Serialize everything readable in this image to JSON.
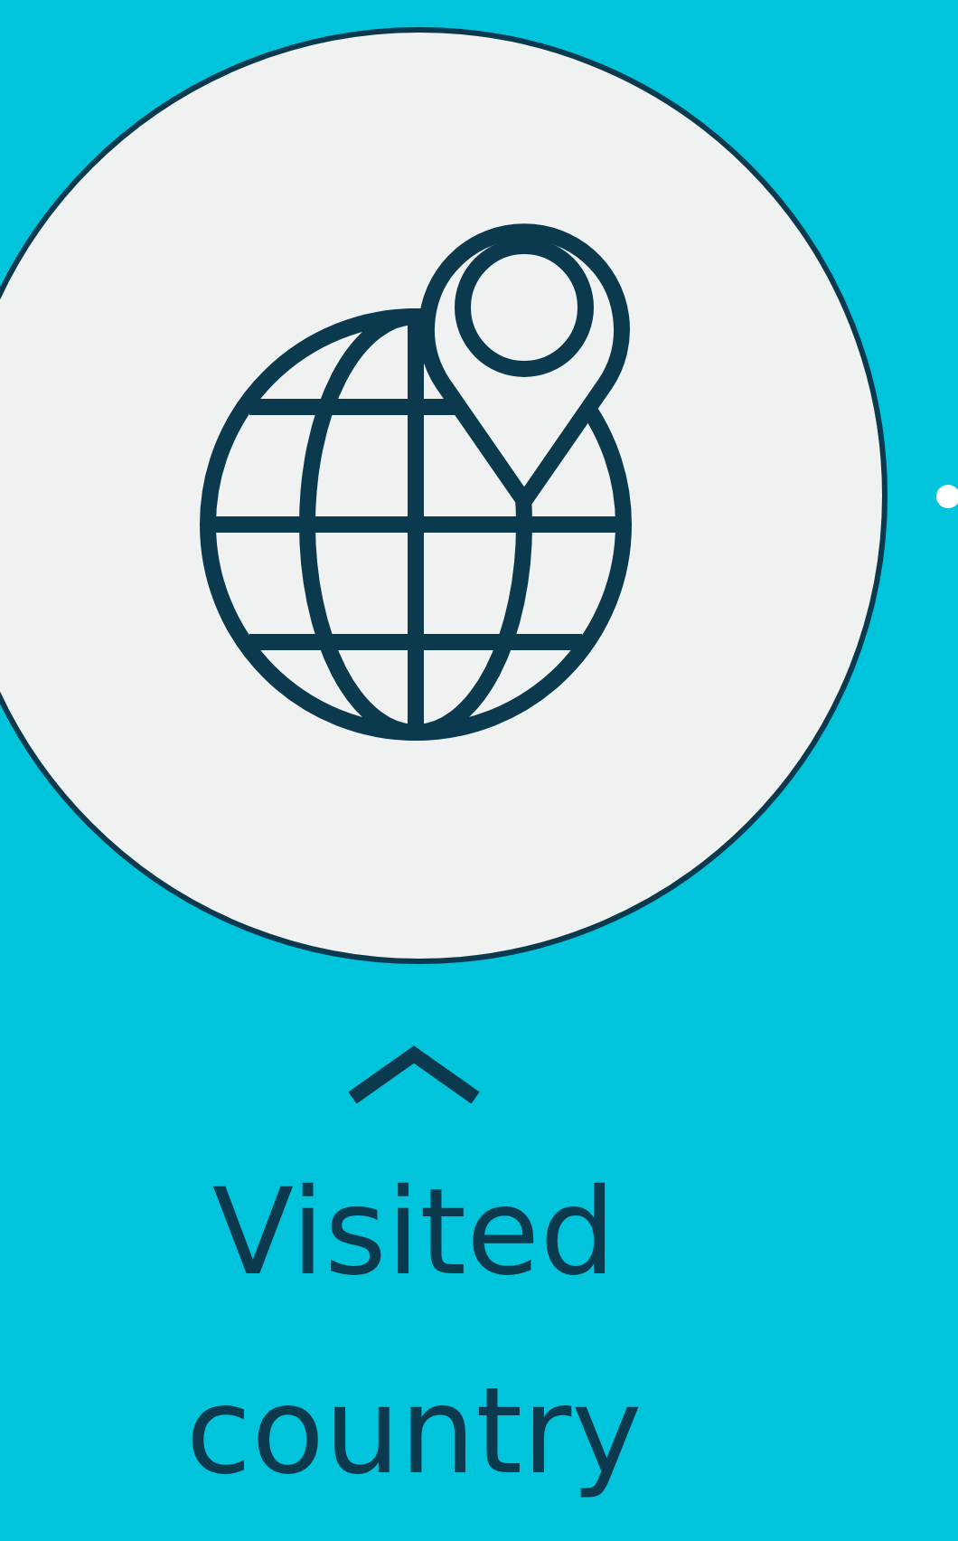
{
  "feature": {
    "caption": "Visited country"
  }
}
